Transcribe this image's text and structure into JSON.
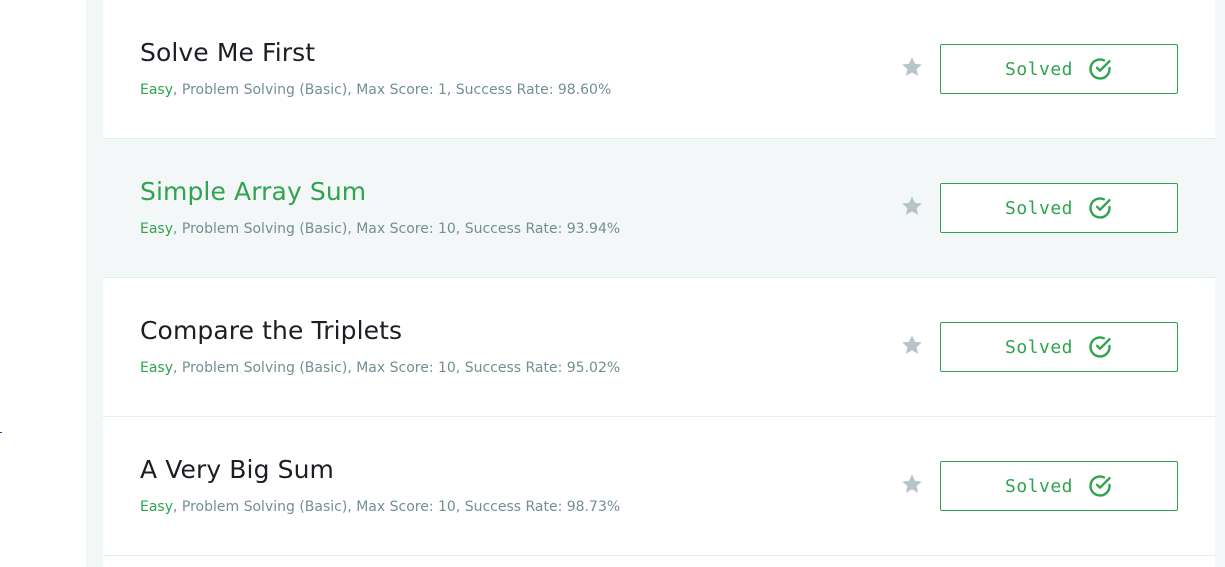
{
  "challenges": [
    {
      "title": "Solve Me First",
      "difficulty": "Easy",
      "details": ", Problem Solving (Basic), Max Score: 1, Success Rate: 98.60%",
      "status": "Solved",
      "hovered": false
    },
    {
      "title": "Simple Array Sum",
      "difficulty": "Easy",
      "details": ", Problem Solving (Basic), Max Score: 10, Success Rate: 93.94%",
      "status": "Solved",
      "hovered": true
    },
    {
      "title": "Compare the Triplets",
      "difficulty": "Easy",
      "details": ", Problem Solving (Basic), Max Score: 10, Success Rate: 95.02%",
      "status": "Solved",
      "hovered": false
    },
    {
      "title": "A Very Big Sum",
      "difficulty": "Easy",
      "details": ", Problem Solving (Basic), Max Score: 10, Success Rate: 98.73%",
      "status": "Solved",
      "hovered": false
    }
  ],
  "icons": {
    "star": "star-icon",
    "solved": "check-circle-icon"
  },
  "colors": {
    "accent_green": "#2ea44f",
    "star_gray": "#b7c4c8",
    "meta_gray": "#738f93",
    "hover_background": "#f3f7f7"
  }
}
